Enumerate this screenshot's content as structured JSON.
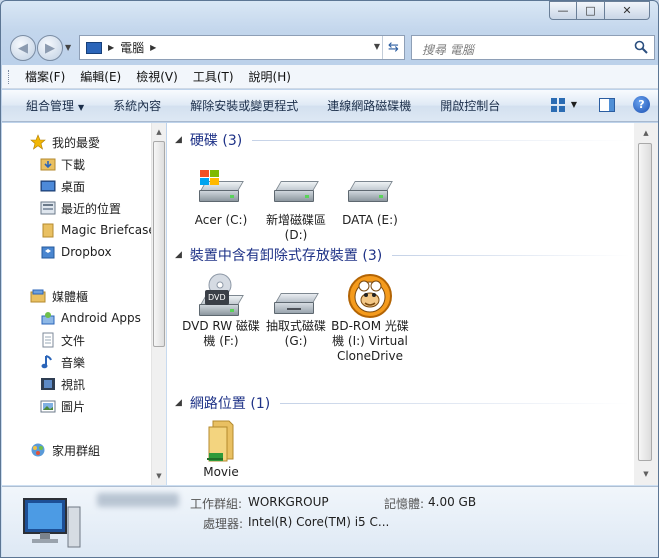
{
  "window": {
    "caption_min": "—",
    "caption_max": "□",
    "caption_close": "✕"
  },
  "address": {
    "crumb": "電腦",
    "search_placeholder": "搜尋 電腦"
  },
  "menu": [
    "檔案(F)",
    "編輯(E)",
    "檢視(V)",
    "工具(T)",
    "說明(H)"
  ],
  "toolbar": {
    "organize": "組合管理",
    "system_properties": "系統內容",
    "uninstall": "解除安裝或變更程式",
    "map_drive": "連線網路磁碟機",
    "control_panel": "開啟控制台",
    "help": "?"
  },
  "nav": {
    "favorites": "我的最愛",
    "downloads": "下載",
    "desktop": "桌面",
    "recent": "最近的位置",
    "magic_briefcase": "Magic Briefcase",
    "dropbox": "Dropbox",
    "libraries": "媒體櫃",
    "android_apps": "Android Apps",
    "documents": "文件",
    "music": "音樂",
    "videos": "視訊",
    "pictures": "圖片",
    "homegroup": "家用群組"
  },
  "groups": {
    "hard_drives": "硬碟 (3)",
    "removable": "裝置中含有卸除式存放裝置 (3)",
    "network": "網路位置 (1)"
  },
  "drives": [
    {
      "label": "Acer (C:)"
    },
    {
      "label": "新增磁碟區 (D:)"
    },
    {
      "label": "DATA (E:)"
    }
  ],
  "removable": [
    {
      "label": "DVD RW 磁碟機 (F:)",
      "badge": "DVD"
    },
    {
      "label": "抽取式磁碟 (G:)"
    },
    {
      "label": "BD-ROM 光碟機 (I:) Virtual CloneDrive"
    }
  ],
  "network": [
    {
      "label": "Movie"
    }
  ],
  "status": {
    "workgroup_label": "工作群組:",
    "workgroup_value": "WORKGROUP",
    "memory_label": "記憶體:",
    "memory_value": "4.00 GB",
    "processor_label": "處理器:",
    "processor_value": "Intel(R) Core(TM) i5 C..."
  },
  "colors": {
    "group_title": "#1e3287",
    "accent": "#2b65b9"
  }
}
